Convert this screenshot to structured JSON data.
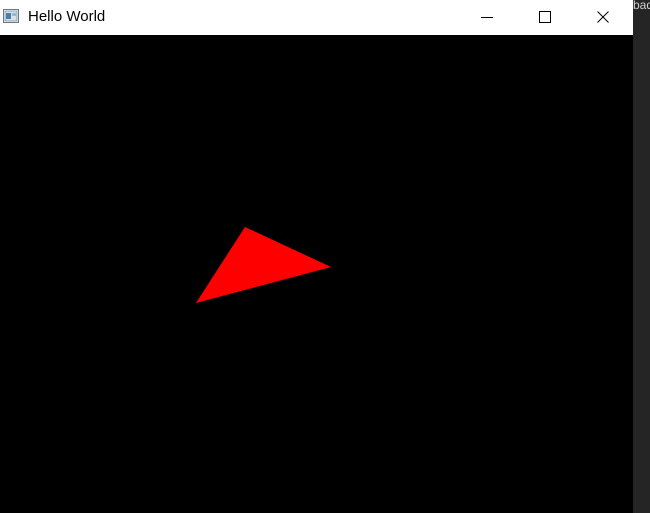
{
  "window": {
    "title": "Hello World",
    "background_color": "#000000",
    "titlebar_color": "#ffffff",
    "controls": {
      "minimize": {
        "icon": "minimize-icon"
      },
      "maximize": {
        "icon": "maximize-icon"
      },
      "close": {
        "icon": "close-icon"
      }
    }
  },
  "scene": {
    "shape": "triangle",
    "fill_color": "#ff0000"
  },
  "background_app": {
    "text_fragment": "bad"
  }
}
